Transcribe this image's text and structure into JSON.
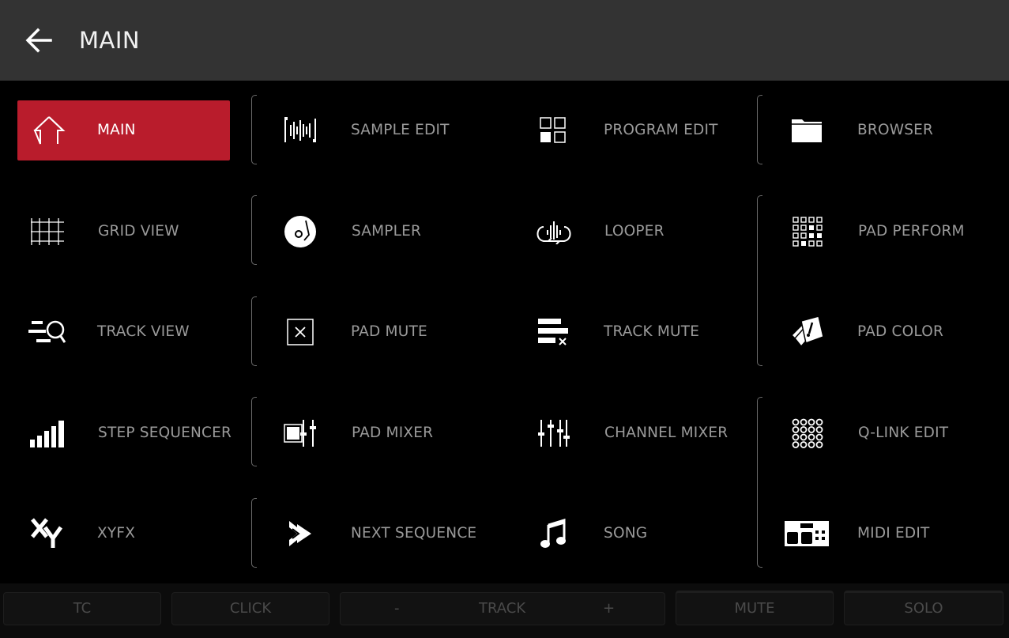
{
  "header": {
    "title": "MAIN"
  },
  "tiles": {
    "main": "MAIN",
    "sample_edit": "SAMPLE EDIT",
    "program_edit": "PROGRAM EDIT",
    "browser": "BROWSER",
    "grid_view": "GRID VIEW",
    "sampler": "SAMPLER",
    "looper": "LOOPER",
    "pad_perform": "PAD PERFORM",
    "track_view": "TRACK VIEW",
    "pad_mute": "PAD MUTE",
    "track_mute": "TRACK MUTE",
    "pad_color": "PAD COLOR",
    "step_sequencer": "STEP SEQUENCER",
    "pad_mixer": "PAD MIXER",
    "channel_mixer": "CHANNEL MIXER",
    "qlink_edit": "Q-LINK EDIT",
    "xyfx": "XYFX",
    "next_sequence": "NEXT SEQUENCE",
    "song": "SONG",
    "midi_edit": "MIDI EDIT"
  },
  "bottom_bar": {
    "tc": "TC",
    "click": "CLICK",
    "track_minus": "-",
    "track": "TRACK",
    "track_plus": "+",
    "mute": "MUTE",
    "solo": "SOLO"
  },
  "colors": {
    "active": "#b91c2c",
    "header": "#333333",
    "label": "#9a9a9a"
  }
}
